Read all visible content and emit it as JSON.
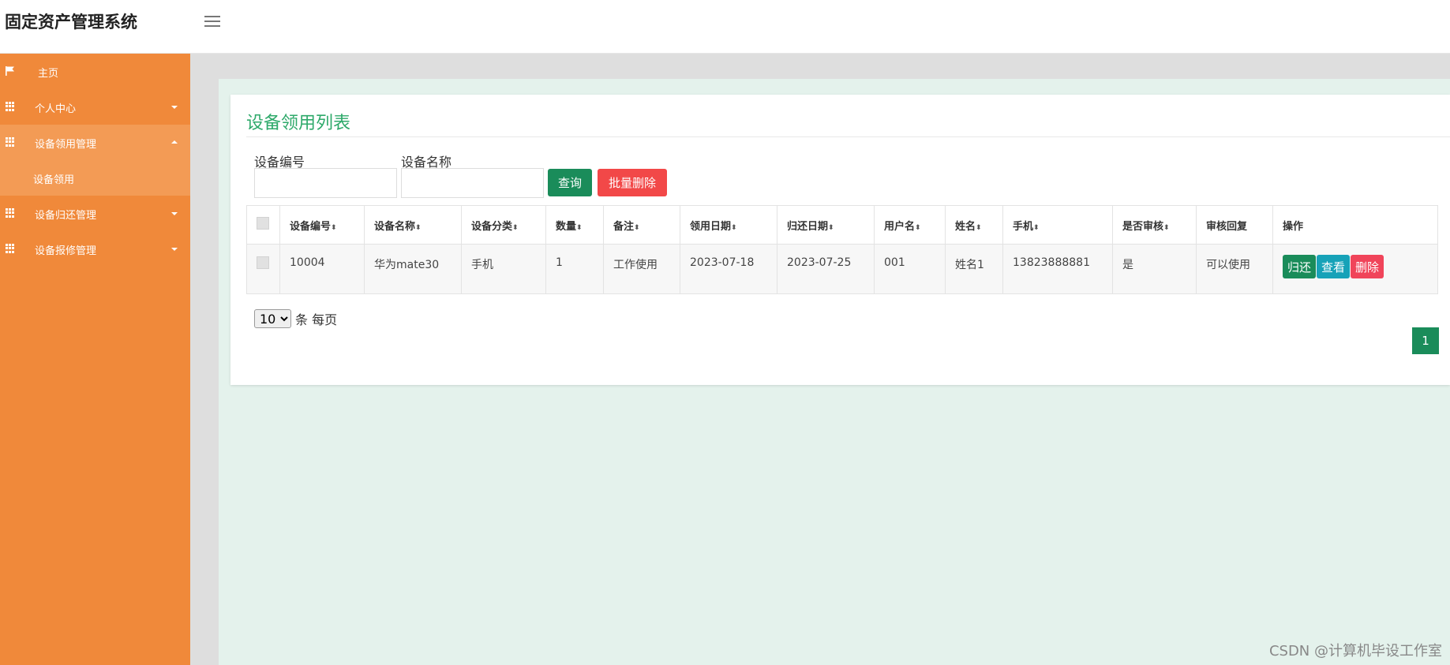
{
  "app": {
    "title": "固定资产管理系统"
  },
  "sidebar": {
    "items": [
      {
        "label": "主页",
        "icon": "flag-icon"
      },
      {
        "label": "个人中心",
        "icon": "grid-icon"
      },
      {
        "label": "设备领用管理",
        "icon": "grid-icon",
        "expanded": true
      },
      {
        "label": "设备归还管理",
        "icon": "grid-icon"
      },
      {
        "label": "设备报修管理",
        "icon": "grid-icon"
      }
    ],
    "sub_items": [
      {
        "label": "设备领用"
      }
    ]
  },
  "panel": {
    "title": "设备领用列表",
    "search": {
      "field1_label": "设备编号",
      "field1_value": "",
      "field2_label": "设备名称",
      "field2_value": "",
      "query_button": "查询",
      "batch_delete_button": "批量删除"
    },
    "table": {
      "sort_glyph": "⬍",
      "columns": [
        "设备编号",
        "设备名称",
        "设备分类",
        "数量",
        "备注",
        "领用日期",
        "归还日期",
        "用户名",
        "姓名",
        "手机",
        "是否审核",
        "审核回复",
        "操作"
      ],
      "rows": [
        {
          "device_no": "10004",
          "device_name": "华为mate30",
          "category": "手机",
          "quantity": "1",
          "remark": "工作使用",
          "borrow_date": "2023-07-18",
          "return_date": "2023-07-25",
          "username": "001",
          "name": "姓名1",
          "phone": "13823888881",
          "audited": "是",
          "audit_reply": "可以使用",
          "actions": {
            "return": "归还",
            "view": "查看",
            "delete": "删除"
          }
        }
      ]
    },
    "pagination": {
      "page_size": "10",
      "page_size_suffix": "条 每页",
      "current_page": "1"
    }
  },
  "watermark": "CSDN @计算机毕设工作室",
  "colors": {
    "sidebar": "#f0893a",
    "sidebar_active": "#f39b55",
    "accent_green": "#1a8c5a",
    "title_green": "#2ea96a",
    "danger": "#f24848",
    "info": "#17a2b8"
  }
}
